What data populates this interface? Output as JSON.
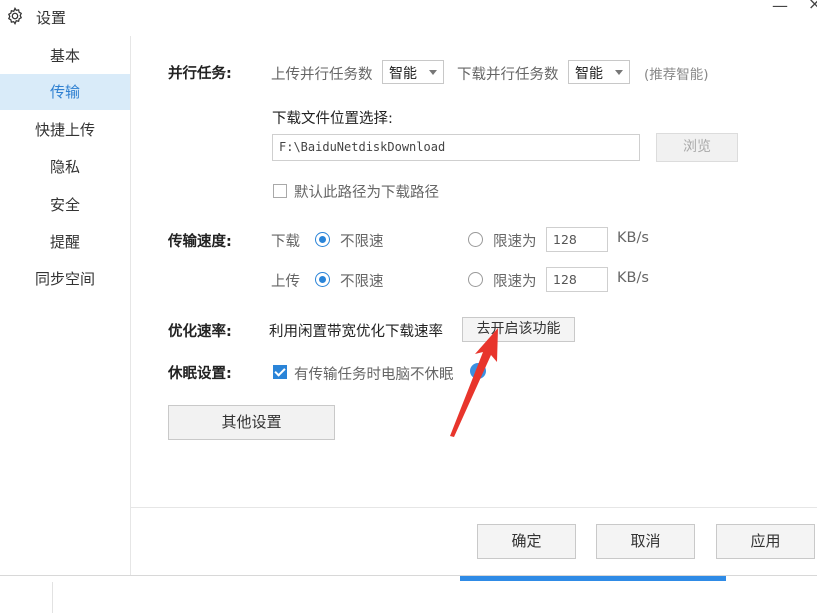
{
  "window": {
    "title": "设置",
    "minimize": "—",
    "close": "×"
  },
  "sidebar": {
    "items": [
      {
        "label": "基本"
      },
      {
        "label": "传输"
      },
      {
        "label": "快捷上传"
      },
      {
        "label": "隐私"
      },
      {
        "label": "安全"
      },
      {
        "label": "提醒"
      },
      {
        "label": "同步空间"
      }
    ],
    "active_index": 1
  },
  "parallel": {
    "label": "并行任务:",
    "upload_label": "上传并行任务数",
    "upload_value": "智能",
    "download_label": "下载并行任务数",
    "download_value": "智能",
    "hint": "(推荐智能)"
  },
  "download_location": {
    "label": "下载文件位置选择:",
    "path": "F:\\BaiduNetdiskDownload",
    "browse_label": "浏览",
    "default_checkbox_label": "默认此路径为下载路径",
    "default_checked": false
  },
  "speed": {
    "label": "传输速度:",
    "download_label": "下载",
    "upload_label": "上传",
    "unlimited_label": "不限速",
    "limit_label": "限速为",
    "download_limit_value": "128",
    "upload_limit_value": "128",
    "unit": "KB/s",
    "download_mode": "unlimited",
    "upload_mode": "unlimited"
  },
  "optimize": {
    "label": "优化速率:",
    "description": "利用闲置带宽优化下载速率",
    "button_label": "去开启该功能"
  },
  "sleep": {
    "label": "休眠设置:",
    "checkbox_label": "有传输任务时电脑不休眠",
    "checked": true
  },
  "other_settings_label": "其他设置",
  "footer": {
    "ok_label": "确定",
    "cancel_label": "取消",
    "apply_label": "应用"
  },
  "colors": {
    "accent": "#2a84d8",
    "sidebar_active_bg": "#d9ebf9",
    "annotation_arrow": "#e8352c"
  }
}
